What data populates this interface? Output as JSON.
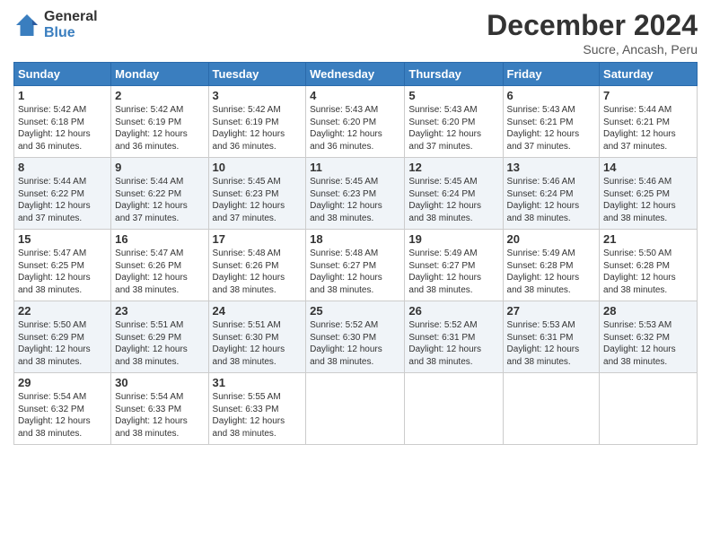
{
  "logo": {
    "general": "General",
    "blue": "Blue"
  },
  "header": {
    "month": "December 2024",
    "location": "Sucre, Ancash, Peru"
  },
  "weekdays": [
    "Sunday",
    "Monday",
    "Tuesday",
    "Wednesday",
    "Thursday",
    "Friday",
    "Saturday"
  ],
  "weeks": [
    [
      {
        "day": "1",
        "info": "Sunrise: 5:42 AM\nSunset: 6:18 PM\nDaylight: 12 hours\nand 36 minutes."
      },
      {
        "day": "2",
        "info": "Sunrise: 5:42 AM\nSunset: 6:19 PM\nDaylight: 12 hours\nand 36 minutes."
      },
      {
        "day": "3",
        "info": "Sunrise: 5:42 AM\nSunset: 6:19 PM\nDaylight: 12 hours\nand 36 minutes."
      },
      {
        "day": "4",
        "info": "Sunrise: 5:43 AM\nSunset: 6:20 PM\nDaylight: 12 hours\nand 36 minutes."
      },
      {
        "day": "5",
        "info": "Sunrise: 5:43 AM\nSunset: 6:20 PM\nDaylight: 12 hours\nand 37 minutes."
      },
      {
        "day": "6",
        "info": "Sunrise: 5:43 AM\nSunset: 6:21 PM\nDaylight: 12 hours\nand 37 minutes."
      },
      {
        "day": "7",
        "info": "Sunrise: 5:44 AM\nSunset: 6:21 PM\nDaylight: 12 hours\nand 37 minutes."
      }
    ],
    [
      {
        "day": "8",
        "info": "Sunrise: 5:44 AM\nSunset: 6:22 PM\nDaylight: 12 hours\nand 37 minutes."
      },
      {
        "day": "9",
        "info": "Sunrise: 5:44 AM\nSunset: 6:22 PM\nDaylight: 12 hours\nand 37 minutes."
      },
      {
        "day": "10",
        "info": "Sunrise: 5:45 AM\nSunset: 6:23 PM\nDaylight: 12 hours\nand 37 minutes."
      },
      {
        "day": "11",
        "info": "Sunrise: 5:45 AM\nSunset: 6:23 PM\nDaylight: 12 hours\nand 38 minutes."
      },
      {
        "day": "12",
        "info": "Sunrise: 5:45 AM\nSunset: 6:24 PM\nDaylight: 12 hours\nand 38 minutes."
      },
      {
        "day": "13",
        "info": "Sunrise: 5:46 AM\nSunset: 6:24 PM\nDaylight: 12 hours\nand 38 minutes."
      },
      {
        "day": "14",
        "info": "Sunrise: 5:46 AM\nSunset: 6:25 PM\nDaylight: 12 hours\nand 38 minutes."
      }
    ],
    [
      {
        "day": "15",
        "info": "Sunrise: 5:47 AM\nSunset: 6:25 PM\nDaylight: 12 hours\nand 38 minutes."
      },
      {
        "day": "16",
        "info": "Sunrise: 5:47 AM\nSunset: 6:26 PM\nDaylight: 12 hours\nand 38 minutes."
      },
      {
        "day": "17",
        "info": "Sunrise: 5:48 AM\nSunset: 6:26 PM\nDaylight: 12 hours\nand 38 minutes."
      },
      {
        "day": "18",
        "info": "Sunrise: 5:48 AM\nSunset: 6:27 PM\nDaylight: 12 hours\nand 38 minutes."
      },
      {
        "day": "19",
        "info": "Sunrise: 5:49 AM\nSunset: 6:27 PM\nDaylight: 12 hours\nand 38 minutes."
      },
      {
        "day": "20",
        "info": "Sunrise: 5:49 AM\nSunset: 6:28 PM\nDaylight: 12 hours\nand 38 minutes."
      },
      {
        "day": "21",
        "info": "Sunrise: 5:50 AM\nSunset: 6:28 PM\nDaylight: 12 hours\nand 38 minutes."
      }
    ],
    [
      {
        "day": "22",
        "info": "Sunrise: 5:50 AM\nSunset: 6:29 PM\nDaylight: 12 hours\nand 38 minutes."
      },
      {
        "day": "23",
        "info": "Sunrise: 5:51 AM\nSunset: 6:29 PM\nDaylight: 12 hours\nand 38 minutes."
      },
      {
        "day": "24",
        "info": "Sunrise: 5:51 AM\nSunset: 6:30 PM\nDaylight: 12 hours\nand 38 minutes."
      },
      {
        "day": "25",
        "info": "Sunrise: 5:52 AM\nSunset: 6:30 PM\nDaylight: 12 hours\nand 38 minutes."
      },
      {
        "day": "26",
        "info": "Sunrise: 5:52 AM\nSunset: 6:31 PM\nDaylight: 12 hours\nand 38 minutes."
      },
      {
        "day": "27",
        "info": "Sunrise: 5:53 AM\nSunset: 6:31 PM\nDaylight: 12 hours\nand 38 minutes."
      },
      {
        "day": "28",
        "info": "Sunrise: 5:53 AM\nSunset: 6:32 PM\nDaylight: 12 hours\nand 38 minutes."
      }
    ],
    [
      {
        "day": "29",
        "info": "Sunrise: 5:54 AM\nSunset: 6:32 PM\nDaylight: 12 hours\nand 38 minutes."
      },
      {
        "day": "30",
        "info": "Sunrise: 5:54 AM\nSunset: 6:33 PM\nDaylight: 12 hours\nand 38 minutes."
      },
      {
        "day": "31",
        "info": "Sunrise: 5:55 AM\nSunset: 6:33 PM\nDaylight: 12 hours\nand 38 minutes."
      },
      null,
      null,
      null,
      null
    ]
  ]
}
